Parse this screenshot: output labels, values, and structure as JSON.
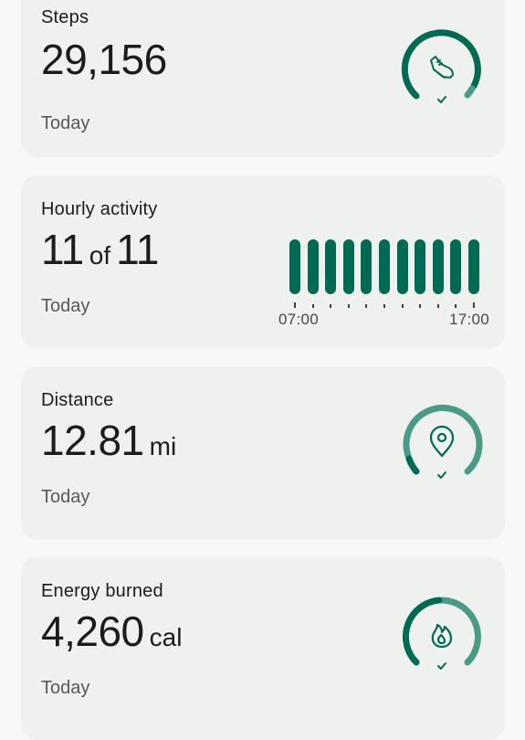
{
  "colors": {
    "accent_dark": "#006b52",
    "accent_light": "#4a9a88",
    "card_bg": "#eff1ee",
    "page_bg": "#f7f9f6"
  },
  "steps": {
    "title": "Steps",
    "value": "29,156",
    "subtitle": "Today",
    "icon": "shoe-icon"
  },
  "hourly": {
    "title": "Hourly activity",
    "value": "11",
    "of_word": "of",
    "total": "11",
    "subtitle": "Today",
    "bars_active": 11,
    "bars_total": 11,
    "start_label": "07:00",
    "end_label": "17:00"
  },
  "distance": {
    "title": "Distance",
    "value": "12.81",
    "unit": "mi",
    "subtitle": "Today",
    "icon": "location-pin-icon"
  },
  "energy": {
    "title": "Energy burned",
    "value": "4,260",
    "unit": "cal",
    "subtitle": "Today",
    "icon": "flame-icon"
  }
}
